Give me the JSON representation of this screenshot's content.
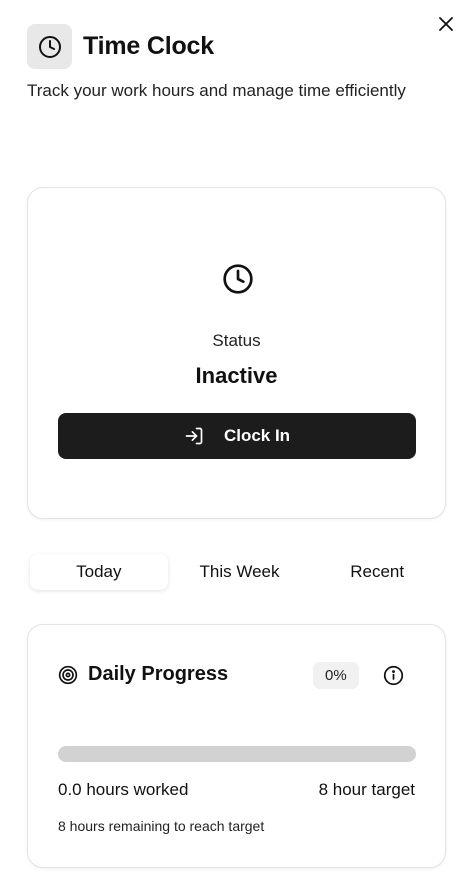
{
  "header": {
    "title": "Time Clock",
    "subtitle": "Track your work hours and manage time efficiently",
    "icon": "clock-icon"
  },
  "close": {
    "icon": "close-icon"
  },
  "status": {
    "icon": "clock-icon",
    "label": "Status",
    "value": "Inactive",
    "button_label": "Clock In",
    "button_icon": "log-in-icon"
  },
  "tabs": [
    {
      "label": "Today",
      "active": true
    },
    {
      "label": "This Week",
      "active": false
    },
    {
      "label": "Recent",
      "active": false
    }
  ],
  "progress": {
    "icon": "target-icon",
    "title": "Daily Progress",
    "percent_label": "0%",
    "percent": 0,
    "info_icon": "info-icon",
    "hours_worked": "0.0 hours worked",
    "target": "8 hour target",
    "remaining": "8 hours remaining to reach target"
  },
  "colors": {
    "button_bg": "#1c1c1c",
    "track": "#d2d2d2",
    "icon_bg": "#e8e8e8"
  }
}
